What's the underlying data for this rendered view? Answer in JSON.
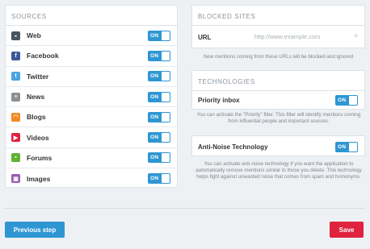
{
  "sources": {
    "heading": "SOURCES",
    "items": [
      {
        "label": "Web",
        "icon": "web-icon",
        "glyph": "◒",
        "color": "#4a5560",
        "toggle": "ON"
      },
      {
        "label": "Facebook",
        "icon": "facebook-icon",
        "glyph": "f",
        "color": "#3b5998",
        "toggle": "ON"
      },
      {
        "label": "Twitter",
        "icon": "twitter-icon",
        "glyph": "t",
        "color": "#4aa3df",
        "toggle": "ON"
      },
      {
        "label": "News",
        "icon": "news-icon",
        "glyph": "≡",
        "color": "#8a8f94",
        "toggle": "ON"
      },
      {
        "label": "Blogs",
        "icon": "blogs-icon",
        "glyph": "◠",
        "color": "#f08a24",
        "toggle": "ON"
      },
      {
        "label": "Videos",
        "icon": "videos-icon",
        "glyph": "▶",
        "color": "#e0233e",
        "toggle": "ON"
      },
      {
        "label": "Forums",
        "icon": "forums-icon",
        "glyph": "▪",
        "color": "#5fb233",
        "toggle": "ON"
      },
      {
        "label": "Images",
        "icon": "images-icon",
        "glyph": "▣",
        "color": "#9b59b6",
        "toggle": "ON"
      }
    ]
  },
  "blocked": {
    "heading": "BLOCKED SITES",
    "url_label": "URL",
    "url_placeholder": "http://www.example.com",
    "add_glyph": "+",
    "help": "New mentions coming from these URLs will be blocked and ignored"
  },
  "technologies": {
    "heading": "TECHNOLOGIES",
    "priority": {
      "label": "Priority inbox",
      "toggle": "ON",
      "help": "You can activate the \"Priority\" filter. This filter will identify mentions coming from influential people and important sources."
    },
    "antinoise": {
      "label": "Anti-Noise Technology",
      "toggle": "ON",
      "help": "You can activate anti-noise technology if you want the application to automatically remove mentions similar to those you delete. This technology helps fight against unwanted noise that comes from spam and homonyms."
    }
  },
  "footer": {
    "prev_label": "Previous step",
    "save_label": "Save"
  },
  "colors": {
    "accent": "#2e96d3",
    "danger": "#e0233e"
  }
}
